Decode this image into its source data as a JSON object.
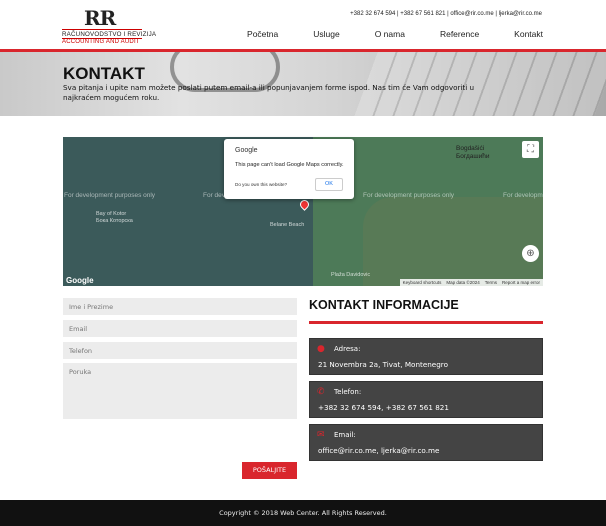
{
  "brand": {
    "mark": "RR",
    "line1": "RAČUNOVODSTVO I REVIZIJA",
    "line2": "ACCOUNTING AND AUDIT"
  },
  "header": {
    "contact_line": "+382 32 674 594 | +382 67 561 821 | office@rir.co.me | ljerka@rir.co.me"
  },
  "nav": {
    "items": [
      {
        "label": "Početna"
      },
      {
        "label": "Usluge"
      },
      {
        "label": "O nama"
      },
      {
        "label": "Reference"
      },
      {
        "label": "Kontakt"
      }
    ]
  },
  "hero": {
    "title": "KONTAKT",
    "text": "Sva pitanja i upite nam možete poslati putem email-a ili popunjavanjem forme ispod. Nas tim će Vam odgovoriti u najkraćem mogućem roku."
  },
  "map": {
    "dev_text": "For development purposes only",
    "places": {
      "bay": "Bay of Kotor\nБока Которска",
      "bogdasici": "Bogdašići\nБогдашићи",
      "beach": "Belane Beach",
      "plaza": "Plaža Davidovic"
    },
    "google_logo": "Google",
    "footer": [
      "Keyboard shortcuts",
      "Map data ©2024",
      "Terms",
      "Report a map error"
    ],
    "dialog": {
      "brand": "Google",
      "message": "This page can't load Google Maps correctly.",
      "question": "Do you own this website?",
      "ok_label": "OK"
    }
  },
  "form": {
    "name_placeholder": "Ime i Prezime",
    "email_placeholder": "Email",
    "phone_placeholder": "Telefon",
    "message_placeholder": "Poruka",
    "submit_label": "POŠALJITE"
  },
  "info": {
    "title": "KONTAKT INFORMACIJE",
    "address": {
      "label": "Adresa:",
      "value": "21 Novembra 2a, Tivat, Montenegro",
      "icon": "map-marker-icon"
    },
    "phone": {
      "label": "Telefon:",
      "value": "+382 32 674 594, +382 67 561 821",
      "icon": "phone-icon"
    },
    "email": {
      "label": "Email:",
      "value": "office@rir.co.me, ljerka@rir.co.me",
      "icon": "envelope-icon"
    }
  },
  "footer": {
    "copyright": "Copyright © 2018 Web Center. All Rights Reserved."
  },
  "colors": {
    "accent": "#d9262d",
    "info_box": "#444444",
    "footer": "#111111"
  }
}
